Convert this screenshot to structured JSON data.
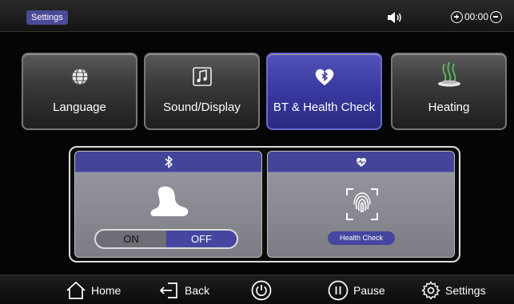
{
  "header": {
    "title": "Settings",
    "timer": "00:00"
  },
  "tabs": [
    {
      "label": "Language",
      "icon": "globe-icon",
      "active": false
    },
    {
      "label": "Sound/Display",
      "icon": "music-note-icon",
      "active": false
    },
    {
      "label": "BT & Health Check",
      "icon": "heart-bluetooth-icon",
      "active": true
    },
    {
      "label": "Heating",
      "icon": "heating-icon",
      "active": false
    }
  ],
  "bluetooth_card": {
    "icon": "bluetooth-icon",
    "image": "massage-chair-icon",
    "toggle": {
      "on_label": "ON",
      "off_label": "OFF",
      "selected": "OFF"
    }
  },
  "health_card": {
    "icon": "heartbeat-icon",
    "image": "fingerprint-icon",
    "button_label": "Health Check"
  },
  "footer": {
    "home": "Home",
    "back": "Back",
    "pause": "Pause",
    "settings": "Settings"
  },
  "colors": {
    "accent": "#4646a0",
    "tab_active": "#3838a0",
    "background": "#000000"
  }
}
